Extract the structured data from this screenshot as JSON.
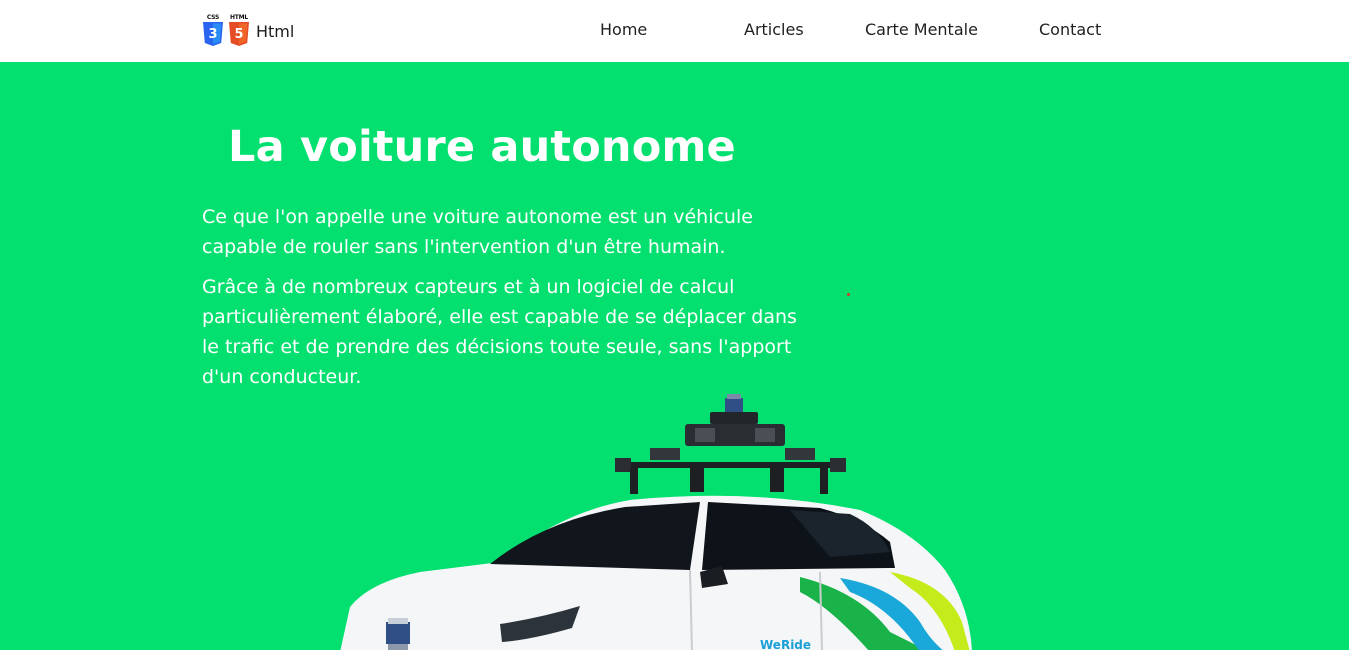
{
  "navbar": {
    "brand": {
      "css_tag": "CSS",
      "html_tag": "HTML",
      "css_logo_number": "3",
      "html_logo_number": "5",
      "label": "Html"
    },
    "links": [
      {
        "label": "Home"
      },
      {
        "label": "Articles"
      },
      {
        "label": "Carte Mentale"
      },
      {
        "label": "Contact"
      }
    ]
  },
  "hero": {
    "title": "La voiture autonome",
    "paragraphs": [
      "Ce que l'on appelle une voiture autonome est un véhicule capable de rouler sans l'intervention d'un être humain.",
      "Grâce à de nombreux capteurs et à un logiciel de calcul particulièrement élaboré, elle est capable de se déplacer dans le trafic et de prendre des décisions toute seule, sans l'apport d'un conducteur."
    ],
    "background_color": "#03e06f",
    "car_logo_text": "WeRide"
  },
  "colors": {
    "css_badge": "#2965f1",
    "html_badge": "#e44d26",
    "text_dark": "#1f1f1f",
    "hero_green": "#03e06f"
  }
}
